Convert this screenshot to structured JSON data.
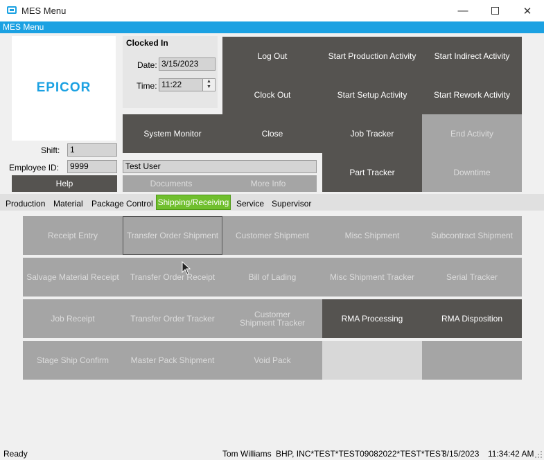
{
  "window": {
    "title": "MES Menu",
    "menu_label": "MES Menu"
  },
  "brand": {
    "logo_text": "EPICOR",
    "accent": "#1ba1e2"
  },
  "clock": {
    "status_label": "Clocked In",
    "date_label": "Date:",
    "date_value": "3/15/2023",
    "time_label": "Time:",
    "time_value": "11:22"
  },
  "employee": {
    "shift_label": "Shift:",
    "shift_value": "1",
    "id_label": "Employee ID:",
    "id_value": "9999",
    "name_value": "Test User"
  },
  "actions": {
    "log_out": "Log Out",
    "start_production": "Start Production Activity",
    "start_indirect": "Start Indirect Activity",
    "clock_out": "Clock Out",
    "start_setup": "Start Setup Activity",
    "start_rework": "Start Rework Activity",
    "system_monitor": "System Monitor",
    "close": "Close",
    "job_tracker": "Job Tracker",
    "end_activity": "End Activity",
    "part_tracker": "Part Tracker",
    "downtime": "Downtime",
    "help": "Help",
    "documents": "Documents",
    "more_info": "More Info"
  },
  "tabs": {
    "production": "Production",
    "material": "Material",
    "package_control": "Package Control",
    "shipping_receiving": "Shipping/Receiving",
    "service": "Service",
    "supervisor": "Supervisor"
  },
  "grid": {
    "receipt_entry": "Receipt Entry",
    "transfer_order_shipment": "Transfer Order Shipment",
    "customer_shipment": "Customer Shipment",
    "misc_shipment": "Misc Shipment",
    "subcontract_shipment": "Subcontract Shipment",
    "salvage_material_receipt": "Salvage Material Receipt",
    "transfer_order_receipt": "Transfer Order Receipt",
    "bill_of_lading": "Bill of Lading",
    "misc_shipment_tracker": "Misc Shipment Tracker",
    "serial_tracker": "Serial Tracker",
    "job_receipt": "Job Receipt",
    "transfer_order_tracker": "Transfer Order Tracker",
    "customer_shipment_tracker": "Customer Shipment Tracker",
    "rma_processing": "RMA Processing",
    "rma_disposition": "RMA Disposition",
    "stage_ship_confirm": "Stage Ship Confirm",
    "master_pack_shipment": "Master Pack Shipment",
    "void_pack": "Void Pack"
  },
  "status": {
    "ready": "Ready",
    "user": "Tom Williams",
    "company": "BHP, INC*TEST*TEST09082022*TEST*TEST",
    "date": "3/15/2023",
    "time": "11:34:42 AM"
  },
  "icons": {
    "app": "window-icon",
    "minimize": "minimize-icon",
    "maximize": "maximize-icon",
    "close": "close-icon",
    "cursor": "mouse-cursor-icon"
  }
}
